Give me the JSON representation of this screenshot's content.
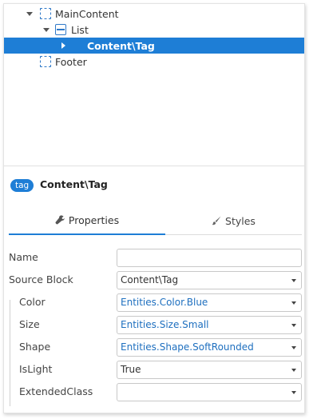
{
  "tree": {
    "items": [
      {
        "label": "MainContent",
        "icon": "container-icon",
        "expanded": true
      },
      {
        "label": "List",
        "icon": "list-icon",
        "expanded": true
      },
      {
        "label": "Content\\Tag",
        "icon": "none",
        "selected": true
      },
      {
        "label": "Footer",
        "icon": "container-icon"
      }
    ]
  },
  "header": {
    "badge": "tag",
    "title": "Content\\Tag"
  },
  "tabs": {
    "properties": "Properties",
    "styles": "Styles"
  },
  "properties": [
    {
      "label": "Name",
      "value": "",
      "type": "text"
    },
    {
      "label": "Source Block",
      "value": "Content\\Tag",
      "type": "select"
    },
    {
      "label": "Color",
      "value": "Entities.Color.Blue",
      "type": "select",
      "link": true
    },
    {
      "label": "Size",
      "value": "Entities.Size.Small",
      "type": "select",
      "link": true
    },
    {
      "label": "Shape",
      "value": "Entities.Shape.SoftRounded",
      "type": "select",
      "link": true
    },
    {
      "label": "IsLight",
      "value": "True",
      "type": "select"
    },
    {
      "label": "ExtendedClass",
      "value": "",
      "type": "select"
    }
  ],
  "colors": {
    "accent": "#1e7ed6",
    "link": "#1e6fbf",
    "icon_blue": "#2f79c8"
  }
}
